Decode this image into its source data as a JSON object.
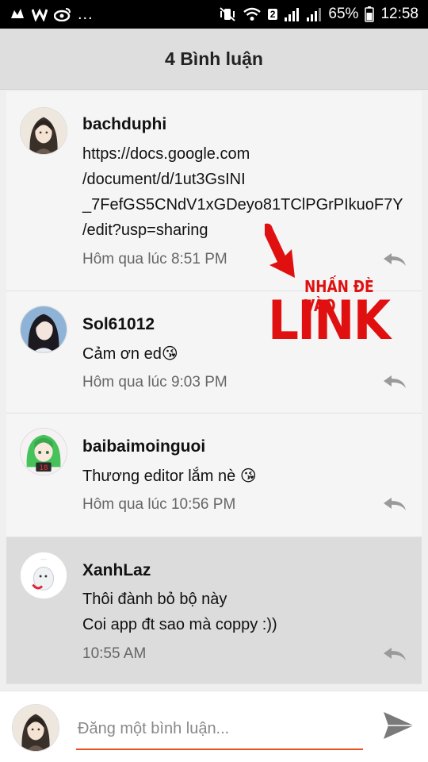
{
  "status_bar": {
    "dots": "...",
    "battery_percent": "65%",
    "time": "12:58",
    "sim_badge": "2",
    "left_icons": [
      "bird-app-icon",
      "vsco-icon",
      "weibo-icon"
    ],
    "right_icons": [
      "mute-vibrate-icon",
      "wifi-icon",
      "signal-icon",
      "signal-icon",
      "battery-icon"
    ]
  },
  "header": {
    "title": "4 Bình luận"
  },
  "comments": [
    {
      "user": "bachduphi",
      "lines": [
        "https://docs.google.com",
        "/document/d/1ut3GsINI",
        "_7FefGS5CNdV1xGDeyo81TClPGrPIkuoF7Y",
        "/edit?usp=sharing"
      ],
      "time": "Hôm qua lúc 8:51 PM"
    },
    {
      "user": "Sol61012",
      "lines": [
        "Cảm ơn ed😘"
      ],
      "time": "Hôm qua lúc 9:03 PM"
    },
    {
      "user": "baibaimoinguoi",
      "lines": [
        "Thương editor lắm nè 😘"
      ],
      "time": "Hôm qua lúc 10:56 PM"
    },
    {
      "user": "XanhLaz",
      "lines": [
        "Thôi đành bỏ bộ này",
        "Coi app đt sao mà coppy :))"
      ],
      "time": "10:55 AM"
    }
  ],
  "annotation": {
    "small": "NHẤN ĐÈ VÀO",
    "big": "LINK",
    "color": "#e01010"
  },
  "input": {
    "placeholder": "Đăng một bình luận...",
    "underline_color": "#e8501e"
  },
  "icons": {
    "reply": "reply-icon",
    "send": "send-icon"
  }
}
